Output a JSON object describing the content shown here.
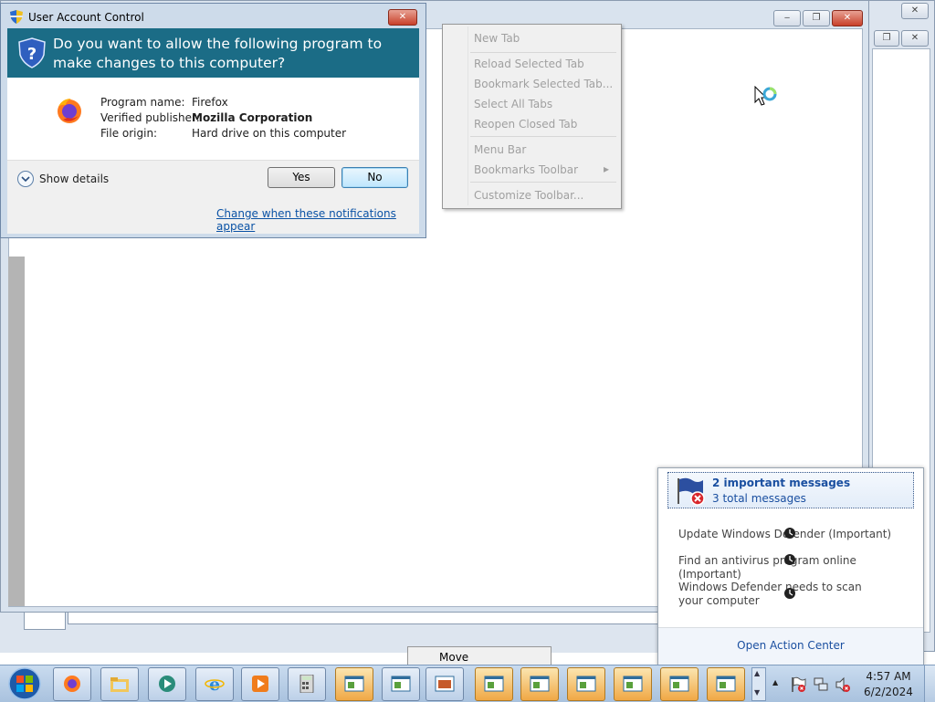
{
  "uac": {
    "title": "User Account Control",
    "question": "Do you want to allow the following program to make changes to this computer?",
    "program_label": "Program name:",
    "program_value": "Firefox",
    "publisher_label": "Verified publisher:",
    "publisher_value": "Mozilla Corporation",
    "origin_label": "File origin:",
    "origin_value": "Hard drive on this computer",
    "show_details": "Show details",
    "yes_label": "Yes",
    "no_label": "No",
    "change_link": "Change when these notifications appear",
    "close_glyph": "✕"
  },
  "firefox_window": {
    "caption_buttons": [
      "‒",
      "❐",
      "✕"
    ]
  },
  "context_menu": {
    "items": [
      {
        "label": "New Tab",
        "enabled": false
      },
      {
        "label": "Reload Selected Tab",
        "enabled": false
      },
      {
        "label": "Bookmark Selected Tab...",
        "enabled": false
      },
      {
        "label": "Select All Tabs",
        "enabled": false
      },
      {
        "label": "Reopen Closed Tab",
        "enabled": false
      },
      {
        "label": "Menu Bar",
        "enabled": false
      },
      {
        "label": "Bookmarks Toolbar",
        "enabled": false,
        "submenu_arrow": "▸"
      },
      {
        "label": "Customize Toolbar...",
        "enabled": false
      }
    ]
  },
  "action_center": {
    "headline": "2 important messages",
    "subline": "3 total messages",
    "messages": [
      "Update Windows Defender (Important)",
      "Find an antivirus program online (Important)",
      "Windows Defender needs to scan your computer"
    ],
    "open_link": "Open Action Center"
  },
  "move_menu": {
    "label": "Move"
  },
  "taskbar": {
    "time": "4:57 AM",
    "date": "6/2/2024",
    "overflow_arrow": "▲",
    "scroll_up": "▲",
    "scroll_down": "▼",
    "pinned": [
      "start-orb",
      "firefox",
      "windows-explorer",
      "media-center",
      "internet-explorer",
      "media-player",
      "calculator"
    ],
    "window_buttons": 9
  },
  "colors": {
    "banner": "#1b6c86",
    "link": "#0a52a5",
    "headline": "#1a4fa0"
  }
}
